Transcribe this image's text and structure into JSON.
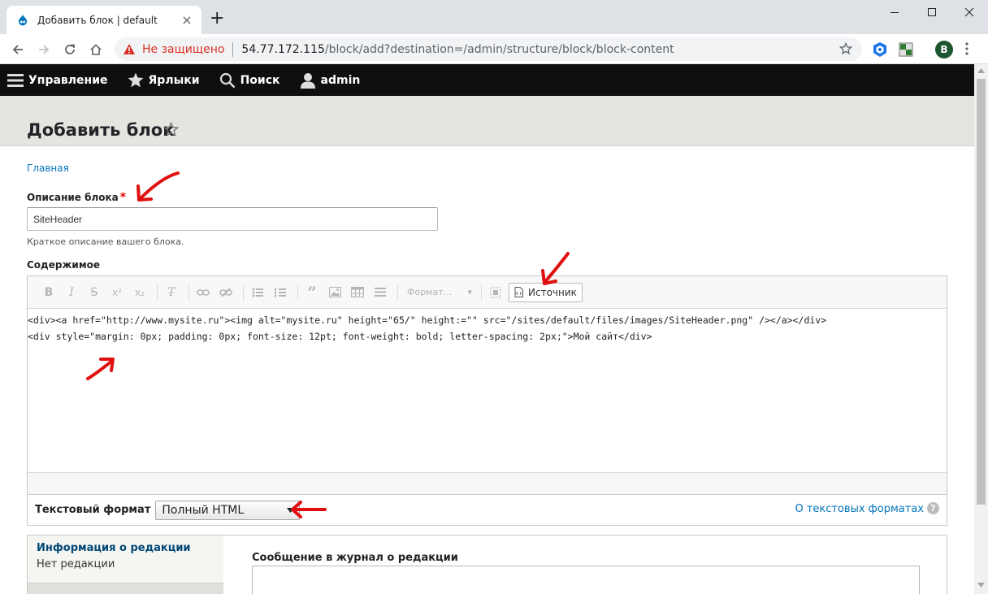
{
  "browser": {
    "tab_title": "Добавить блок | default",
    "security_label": "Не защищено",
    "url_host": "54.77.172.115",
    "url_path": "/block/add?destination=/admin/structure/block/block-content",
    "profile_initial": "B"
  },
  "admin_toolbar": {
    "items": [
      {
        "label": "Управление",
        "icon": "menu-icon"
      },
      {
        "label": "Ярлыки",
        "icon": "star-icon"
      },
      {
        "label": "Поиск",
        "icon": "search-icon"
      },
      {
        "label": "admin",
        "icon": "user-icon"
      }
    ]
  },
  "page": {
    "title": "Добавить блок",
    "breadcrumb": "Главная"
  },
  "form": {
    "description_label": "Описание блока",
    "required_mark": "*",
    "description_value": "SiteHeader",
    "description_help": "Краткое описание вашего блока.",
    "content_label": "Содержимое",
    "format_placeholder": "Формат...",
    "source_button": "Источник",
    "code_line1": "<div><a href=\"http://www.mysite.ru\"><img alt=\"mysite.ru\" height=\"65/\" height:=\"\" src=\"/sites/default/files/images/SiteHeader.png\" /></a></div>",
    "code_line2": "<div style=\"margin: 0px; padding: 0px; font-size: 12pt; font-weight: bold; letter-spacing: 2px;\">Мой сайт</div>",
    "text_format_label": "Текстовый формат",
    "text_format_value": "Полный HTML",
    "text_format_help_link": "О текстовых форматах",
    "help_icon_glyph": "?"
  },
  "revision": {
    "title": "Информация о редакции",
    "subtitle": "Нет редакции",
    "log_label": "Сообщение в журнал о редакции"
  },
  "colors": {
    "admin_bar": "#0f0f0f",
    "link": "#0074bd",
    "annotation_arrow": "#e01010",
    "security_warning": "#d93025"
  }
}
